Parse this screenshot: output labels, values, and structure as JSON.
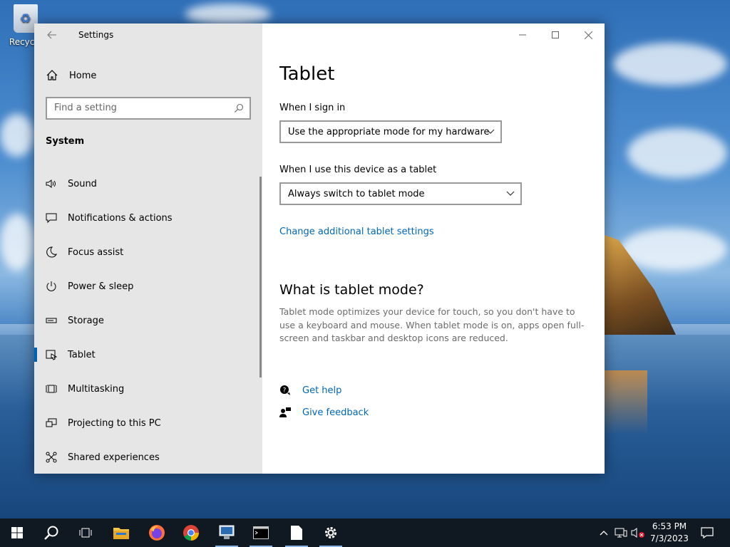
{
  "desktop": {
    "recycle_label": "Recycle"
  },
  "window": {
    "title": "Settings",
    "sidebar": {
      "home": "Home",
      "search_placeholder": "Find a setting",
      "section": "System",
      "items": [
        {
          "label": "Sound",
          "icon": "speaker-icon"
        },
        {
          "label": "Notifications & actions",
          "icon": "notification-icon"
        },
        {
          "label": "Focus assist",
          "icon": "moon-icon"
        },
        {
          "label": "Power & sleep",
          "icon": "power-icon"
        },
        {
          "label": "Storage",
          "icon": "storage-icon"
        },
        {
          "label": "Tablet",
          "icon": "tablet-icon",
          "active": true
        },
        {
          "label": "Multitasking",
          "icon": "multitasking-icon"
        },
        {
          "label": "Projecting to this PC",
          "icon": "projecting-icon"
        },
        {
          "label": "Shared experiences",
          "icon": "shared-icon"
        }
      ]
    },
    "main": {
      "title": "Tablet",
      "sign_in_label": "When I sign in",
      "sign_in_value": "Use the appropriate mode for my hardware",
      "tablet_label": "When I use this device as a tablet",
      "tablet_value": "Always switch to tablet mode",
      "additional_link": "Change additional tablet settings",
      "about_title": "What is tablet mode?",
      "about_text": "Tablet mode optimizes your device for touch, so you don't have to use a keyboard and mouse. When tablet mode is on, apps open full-screen and taskbar and desktop icons are reduced.",
      "get_help": "Get help",
      "give_feedback": "Give feedback"
    }
  },
  "taskbar": {
    "time": "6:53 PM",
    "date": "7/3/2023",
    "accent": "#0063b1"
  }
}
